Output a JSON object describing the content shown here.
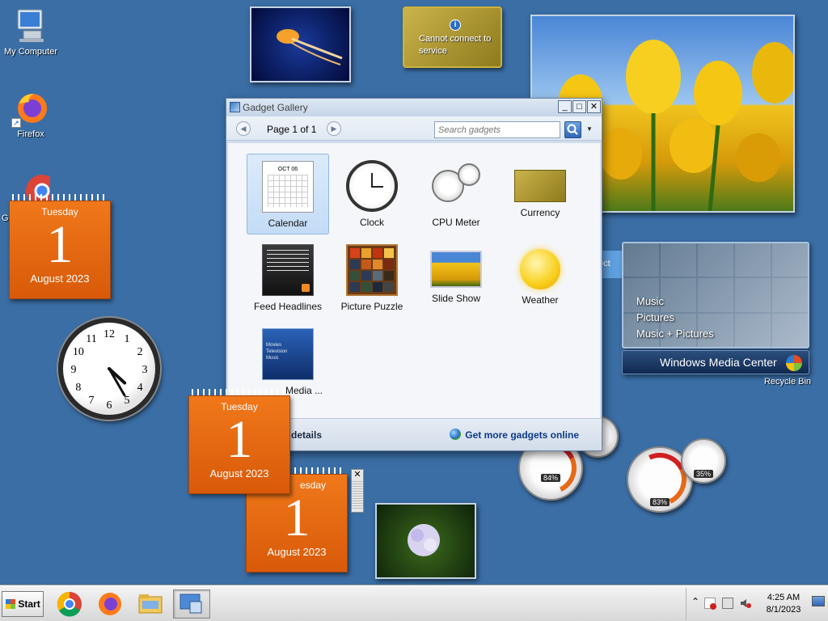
{
  "desktop_icons": [
    {
      "label": "My Computer"
    },
    {
      "label": "Firefox"
    },
    {
      "label": "Go"
    },
    {
      "label": "Recycle Bin"
    }
  ],
  "calendars": [
    {
      "dow": "Tuesday",
      "day": "1",
      "monthyear": "August 2023"
    },
    {
      "dow": "Tuesday",
      "day": "1",
      "monthyear": "August 2023"
    },
    {
      "dow": "esday",
      "day": "1",
      "monthyear": "August 2023"
    }
  ],
  "currency_gadget": {
    "message": "Cannot connect to service"
  },
  "gallery": {
    "title": "Gadget Gallery",
    "page_label": "Page 1 of 1",
    "search_placeholder": "Search gadgets",
    "minimize": "_",
    "maximize": "□",
    "close": "✕",
    "prev": "◀",
    "next": "▶",
    "dropdown": "▼",
    "calendar_thumb_month": "OCT 06",
    "items": [
      {
        "label": "Calendar"
      },
      {
        "label": "Clock"
      },
      {
        "label": "CPU Meter"
      },
      {
        "label": "Currency"
      },
      {
        "label": "Feed Headlines"
      },
      {
        "label": "Picture Puzzle"
      },
      {
        "label": "Slide Show"
      },
      {
        "label": "Weather"
      },
      {
        "label": "Media ..."
      }
    ],
    "media_thumb_lines": [
      "Movies",
      "Television",
      "Music"
    ],
    "details_label": "details",
    "more_label": "Get more gadgets online"
  },
  "media_center": {
    "menu": [
      "Music",
      "Pictures",
      "Music + Pictures"
    ],
    "brand": "Windows Media Center",
    "partial_label": "ect"
  },
  "meters": [
    {
      "value": "84%"
    },
    {
      "value": "83%"
    },
    {
      "value": "35%"
    }
  ],
  "clock_numbers": [
    "12",
    "1",
    "2",
    "3",
    "4",
    "5",
    "6",
    "7",
    "8",
    "9",
    "10",
    "11"
  ],
  "taskbar": {
    "start_label": "Start",
    "time": "4:25 AM",
    "date": "8/1/2023",
    "tray_arrow": "⌃"
  },
  "colors": {
    "desktop": "#3a6ea5",
    "calendar": "#e8670f",
    "accent": "#0c3a8a"
  }
}
